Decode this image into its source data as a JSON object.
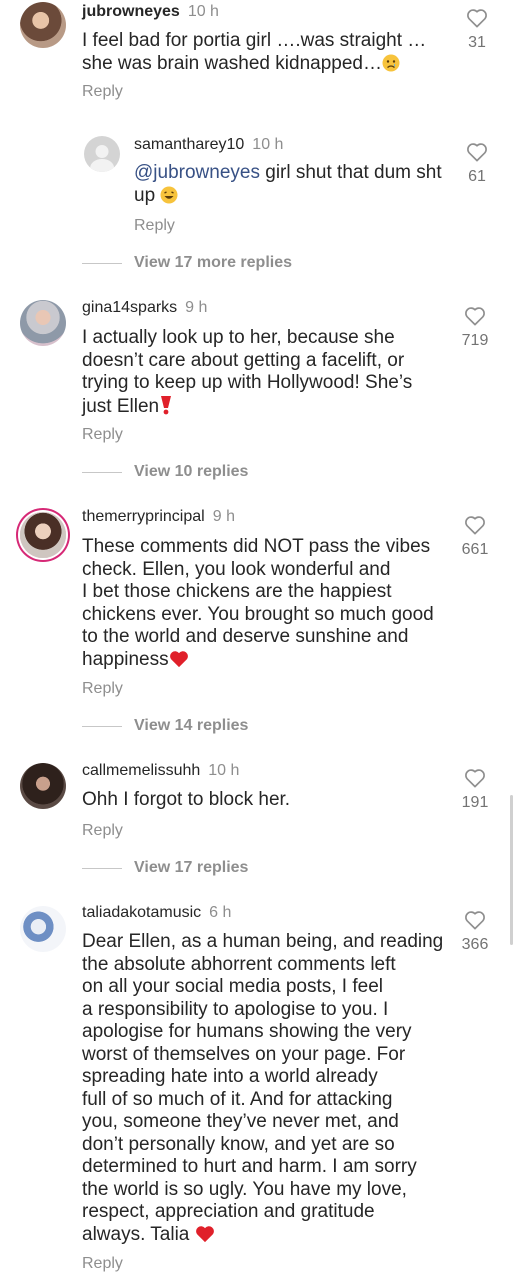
{
  "comments": [
    {
      "username": "jubrowneyes",
      "time": "10 h",
      "lines": [
        "I feel bad for portia  girl ….was straight …",
        "she was brain washed kidnapped…"
      ],
      "likes": "31",
      "reply_label": "Reply",
      "replies": [
        {
          "username": "samantharey10",
          "time": "10 h",
          "mention": "@jubrowneyes",
          "text_first": " girl shut that dum sht",
          "text_second": "up",
          "likes": "61",
          "reply_label": "Reply"
        }
      ],
      "view_replies": "View 17 more replies"
    },
    {
      "username": "gina14sparks",
      "time": "9 h",
      "lines": [
        "I actually look up to her, because she",
        "doesn’t care about getting a facelift, or",
        "trying to keep up with Hollywood! She’s",
        "just Ellen"
      ],
      "likes": "719",
      "reply_label": "Reply",
      "view_replies": "View 10 replies"
    },
    {
      "username": "themerryprincipal",
      "time": "9 h",
      "lines": [
        "These comments did NOT pass the vibes",
        "check. Ellen, you look wonderful and",
        "I bet those chickens are the happiest",
        "chickens ever. You brought so much good",
        "to the world and deserve sunshine and",
        "happiness"
      ],
      "likes": "661",
      "reply_label": "Reply",
      "view_replies": "View 14 replies"
    },
    {
      "username": "callmemelissuhh",
      "time": "10 h",
      "lines": [
        "Ohh I forgot to block her."
      ],
      "likes": "191",
      "reply_label": "Reply",
      "view_replies": "View 17 replies"
    },
    {
      "username": "taliadakotamusic",
      "time": "6 h",
      "lines": [
        "Dear Ellen, as a human being, and reading",
        "the absolute abhorrent comments left",
        "on all your social media posts, I feel",
        "a responsibility to apologise to you. I",
        "apologise for humans showing the very",
        "worst of themselves on your page. For",
        "spreading hate into a world already",
        "full of so much of it. And for attacking",
        "you, someone they’ve never met, and",
        "don’t personally know, and yet are so",
        "determined to hurt and harm. I am sorry",
        "the world is so ugly. You have my love,",
        "respect, appreciation and gratitude",
        "always. Talia "
      ],
      "likes": "366",
      "reply_label": "Reply"
    }
  ],
  "icons": {
    "like": "heart-outline-icon",
    "emoji_sad": "sad-face-emoji",
    "emoji_laugh": "laughing-face-emoji",
    "emoji_heart": "red-heart-emoji",
    "emoji_exclaim": "red-exclamation-emoji"
  },
  "colors": {
    "text": "#262626",
    "muted": "#8e8e8e",
    "mention": "#385185",
    "heart": "#e0245e"
  }
}
